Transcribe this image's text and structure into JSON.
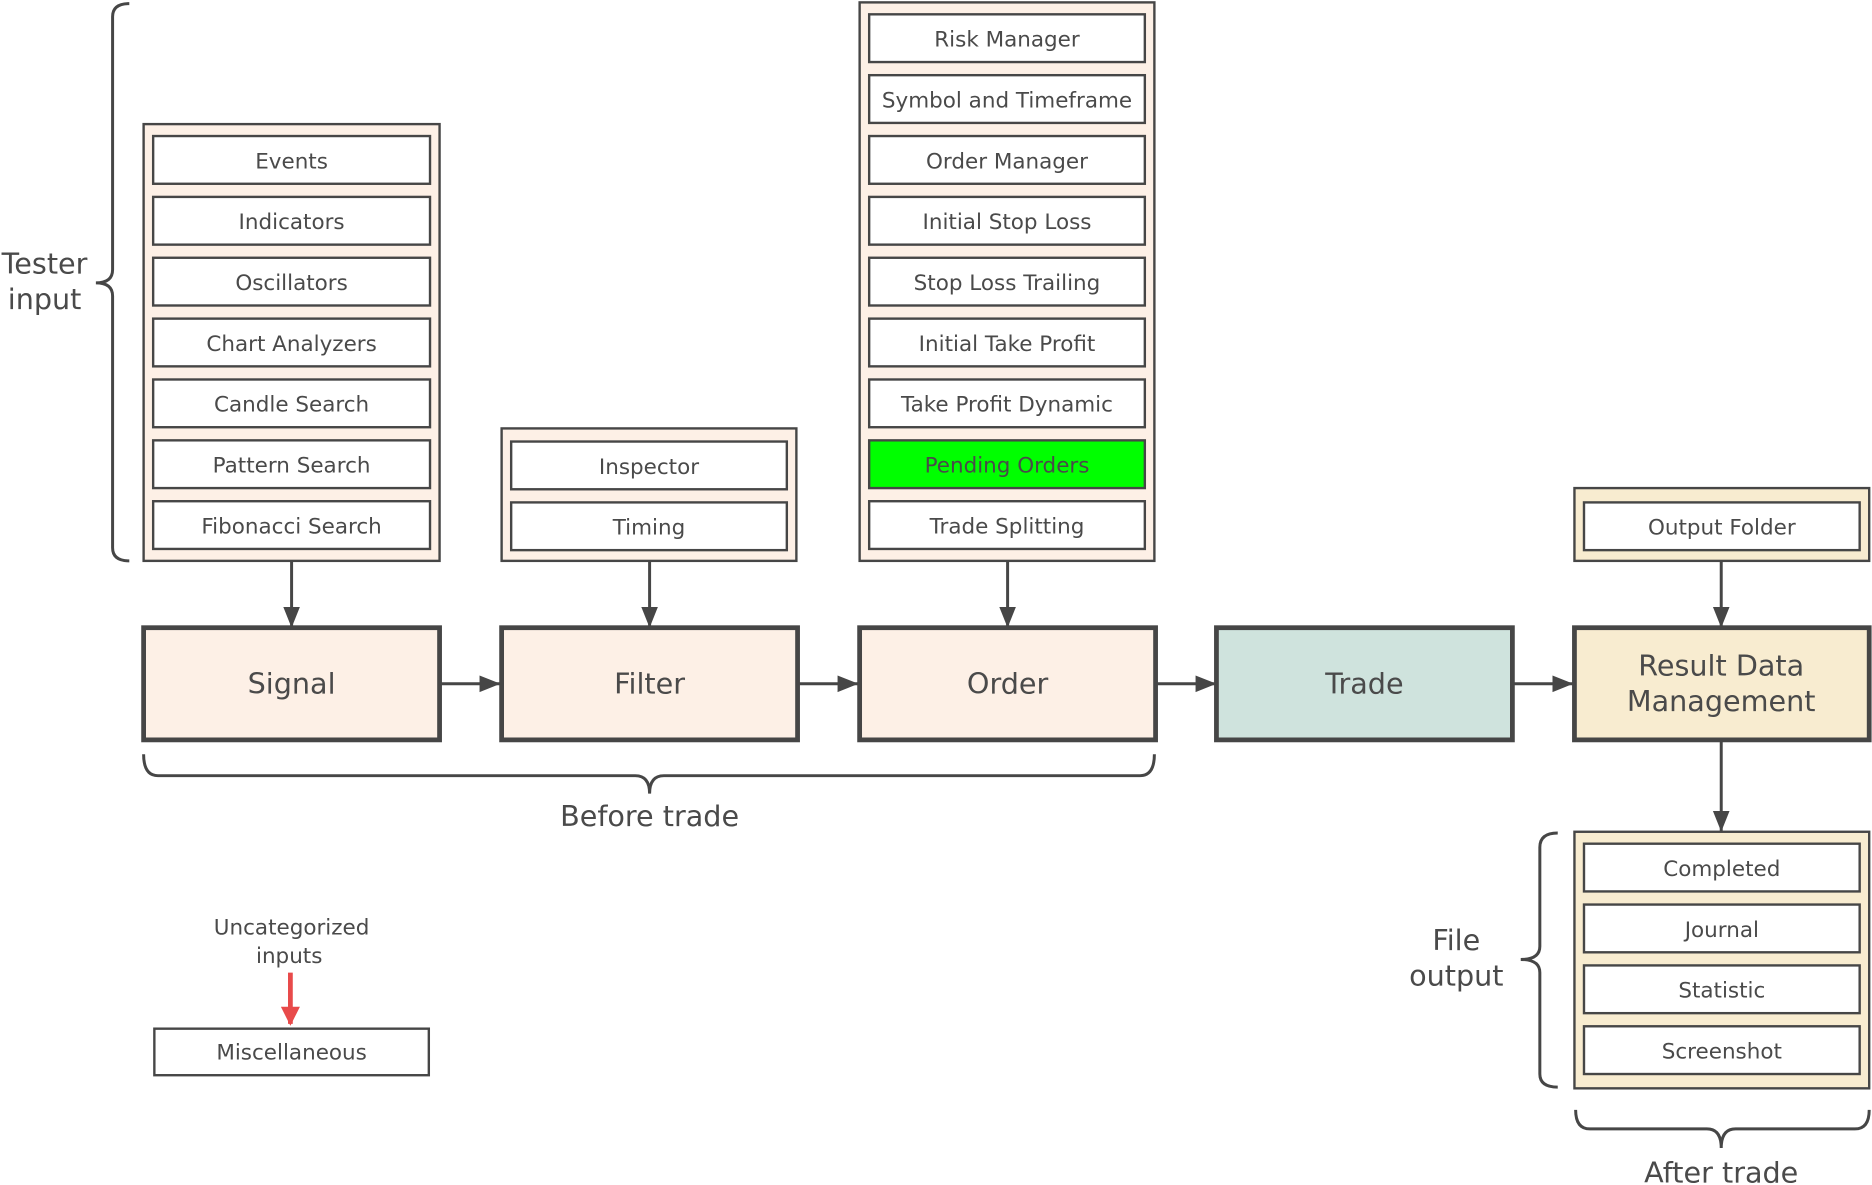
{
  "colors": {
    "stroke": "#464646",
    "group_fill": "#fdf0e6",
    "trade_fill": "#cfe3dd",
    "result_fill": "#f8ecd0",
    "highlight": "#00ff00",
    "red_arrow": "#e84a4a"
  },
  "groups": {
    "signal": [
      "Events",
      "Indicators",
      "Oscillators",
      "Chart Analyzers",
      "Candle Search",
      "Pattern Search",
      "Fibonacci Search"
    ],
    "filter": [
      "Inspector",
      "Timing"
    ],
    "order": [
      "Risk Manager",
      "Symbol and Timeframe",
      "Order Manager",
      "Initial Stop Loss",
      "Stop Loss Trailing",
      "Initial Take Profit",
      "Take Profit Dynamic",
      "Pending Orders",
      "Trade Splitting"
    ],
    "order_highlighted": "Pending Orders",
    "output": [
      "Output Folder"
    ],
    "file_output": [
      "Completed",
      "Journal",
      "Statistic",
      "Screenshot"
    ]
  },
  "stages": [
    "Signal",
    "Filter",
    "Order",
    "Trade"
  ],
  "result_stage": [
    "Result Data",
    "Management"
  ],
  "labels": {
    "tester_input": [
      "Tester",
      "input"
    ],
    "before_trade": "Before trade",
    "after_trade": "After trade",
    "file_output": [
      "File",
      "output"
    ],
    "uncategorized": [
      "Uncategorized",
      "inputs"
    ],
    "miscellaneous": "Miscellaneous"
  }
}
